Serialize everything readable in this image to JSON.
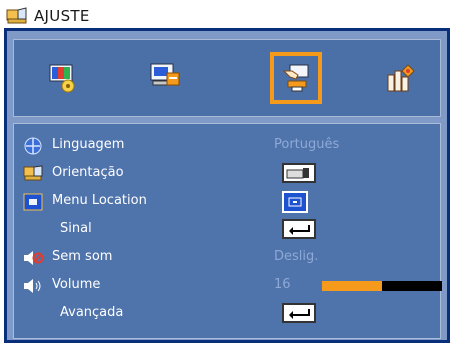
{
  "window": {
    "title": "AJUSTE"
  },
  "tabs": [
    {
      "id": "image",
      "icon": "image-settings-icon",
      "active": false
    },
    {
      "id": "display",
      "icon": "display-settings-icon",
      "active": false
    },
    {
      "id": "setup",
      "icon": "setup-hand-icon",
      "active": true
    },
    {
      "id": "options",
      "icon": "options-icon",
      "active": false
    }
  ],
  "menu": {
    "items": [
      {
        "label": "Linguagem",
        "value": "Português",
        "icon": "globe-icon"
      },
      {
        "label": "Orientação",
        "value_icon": "projector-orientation-icon",
        "icon": "orientation-icon"
      },
      {
        "label": "Menu Location",
        "value_icon": "menu-location-icon",
        "icon": "menu-location-icon"
      },
      {
        "label": "Sinal",
        "value_icon": "enter-icon"
      },
      {
        "label": "Sem som",
        "value": "Deslig.",
        "icon": "mute-icon"
      },
      {
        "label": "Volume",
        "value": "16",
        "icon": "volume-icon",
        "level": 0.5
      },
      {
        "label": "Avançada",
        "value_icon": "enter-icon"
      }
    ]
  },
  "colors": {
    "accent": "#f59a1b",
    "frame": "#0a2f7a",
    "panel": "#4f73ab",
    "value_text": "#8ea9d5"
  }
}
